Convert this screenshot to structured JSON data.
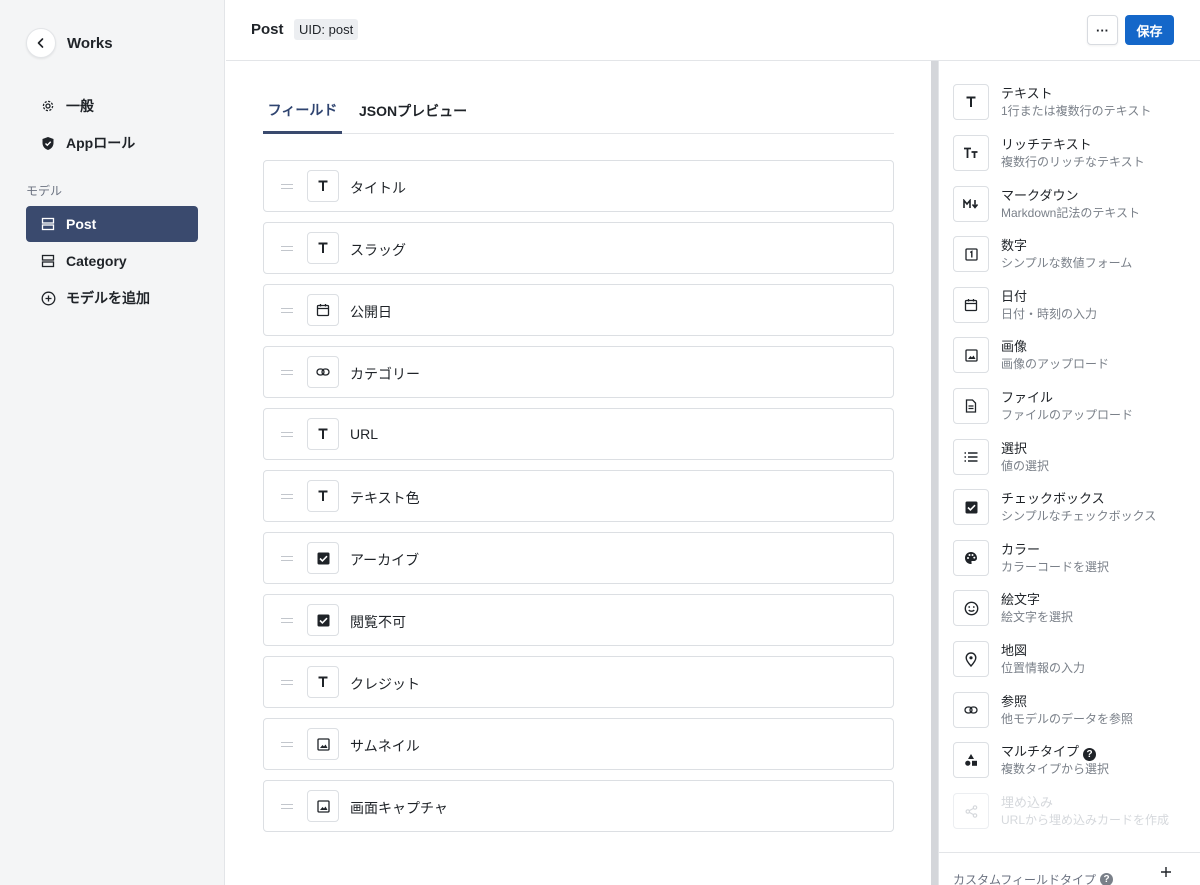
{
  "sidebar": {
    "back_icon": "chevron-left-icon",
    "title": "Works",
    "menu": [
      {
        "label": "一般",
        "icon": "gear-icon"
      },
      {
        "label": "Appロール",
        "icon": "shield-icon"
      }
    ],
    "section_label": "モデル",
    "models": [
      {
        "label": "Post",
        "icon": "model-icon",
        "active": true
      },
      {
        "label": "Category",
        "icon": "model-icon",
        "active": false
      }
    ],
    "add_model_label": "モデルを追加"
  },
  "header": {
    "title": "Post",
    "uid": "UID: post",
    "more_label": "···",
    "save_label": "保存",
    "accent_color": "#1467c9"
  },
  "tabs": [
    {
      "label": "フィールド",
      "active": true
    },
    {
      "label": "JSONプレビュー",
      "active": false
    }
  ],
  "fields": [
    {
      "label": "タイトル",
      "icon": "text-icon"
    },
    {
      "label": "スラッグ",
      "icon": "text-icon"
    },
    {
      "label": "公開日",
      "icon": "calendar-icon"
    },
    {
      "label": "カテゴリー",
      "icon": "link-icon"
    },
    {
      "label": "URL",
      "icon": "text-icon"
    },
    {
      "label": "テキスト色",
      "icon": "text-icon"
    },
    {
      "label": "アーカイブ",
      "icon": "checkbox-icon"
    },
    {
      "label": "閲覧不可",
      "icon": "checkbox-icon"
    },
    {
      "label": "クレジット",
      "icon": "text-icon"
    },
    {
      "label": "サムネイル",
      "icon": "image-icon"
    },
    {
      "label": "画面キャプチャ",
      "icon": "image-icon"
    }
  ],
  "field_types": [
    {
      "name": "テキスト",
      "desc": "1行または複数行のテキスト",
      "icon": "text-icon"
    },
    {
      "name": "リッチテキスト",
      "desc": "複数行のリッチなテキスト",
      "icon": "rich-text-icon"
    },
    {
      "name": "マークダウン",
      "desc": "Markdown記法のテキスト",
      "icon": "markdown-icon"
    },
    {
      "name": "数字",
      "desc": "シンプルな数値フォーム",
      "icon": "number-icon"
    },
    {
      "name": "日付",
      "desc": "日付・時刻の入力",
      "icon": "calendar-icon"
    },
    {
      "name": "画像",
      "desc": "画像のアップロード",
      "icon": "image-icon"
    },
    {
      "name": "ファイル",
      "desc": "ファイルのアップロード",
      "icon": "file-icon"
    },
    {
      "name": "選択",
      "desc": "値の選択",
      "icon": "list-icon"
    },
    {
      "name": "チェックボックス",
      "desc": "シンプルなチェックボックス",
      "icon": "checkbox-icon"
    },
    {
      "name": "カラー",
      "desc": "カラーコードを選択",
      "icon": "palette-icon"
    },
    {
      "name": "絵文字",
      "desc": "絵文字を選択",
      "icon": "emoji-icon"
    },
    {
      "name": "地図",
      "desc": "位置情報の入力",
      "icon": "map-pin-icon"
    },
    {
      "name": "参照",
      "desc": "他モデルのデータを参照",
      "icon": "link-icon"
    },
    {
      "name": "マルチタイプ",
      "desc": "複数タイプから選択",
      "icon": "shapes-icon",
      "help": true
    },
    {
      "name": "埋め込み",
      "desc": "URLから埋め込みカードを作成",
      "icon": "share-icon",
      "disabled": true
    }
  ],
  "custom_field_type": {
    "label": "カスタムフィールドタイプ",
    "add_icon": "plus-icon"
  }
}
